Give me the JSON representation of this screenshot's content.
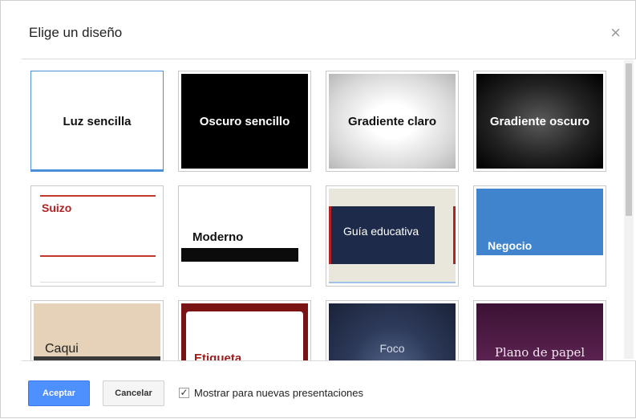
{
  "dialog": {
    "title": "Elige un diseño",
    "close_icon": "×"
  },
  "themes": [
    {
      "name": "Luz sencilla",
      "style": "light",
      "selected": true
    },
    {
      "name": "Oscuro sencillo",
      "style": "dark"
    },
    {
      "name": "Gradiente claro",
      "style": "gradlight"
    },
    {
      "name": "Gradiente oscuro",
      "style": "graddark"
    },
    {
      "name": "Suizo",
      "style": "suizo"
    },
    {
      "name": "Moderno",
      "style": "moderno"
    },
    {
      "name": "Guía educativa",
      "style": "guia"
    },
    {
      "name": "Negocio",
      "style": "negocio"
    },
    {
      "name": "Caqui",
      "style": "caqui"
    },
    {
      "name": "Etiqueta",
      "style": "etiqueta"
    },
    {
      "name": "Foco",
      "style": "foco"
    },
    {
      "name": "Plano de papel",
      "style": "plano"
    }
  ],
  "footer": {
    "accept_label": "Aceptar",
    "cancel_label": "Cancelar",
    "checkbox_checked": true,
    "checkbox_label": "Mostrar para nuevas presentaciones"
  },
  "colors": {
    "primary": "#4d90fe",
    "selection": "#4a90d9"
  }
}
